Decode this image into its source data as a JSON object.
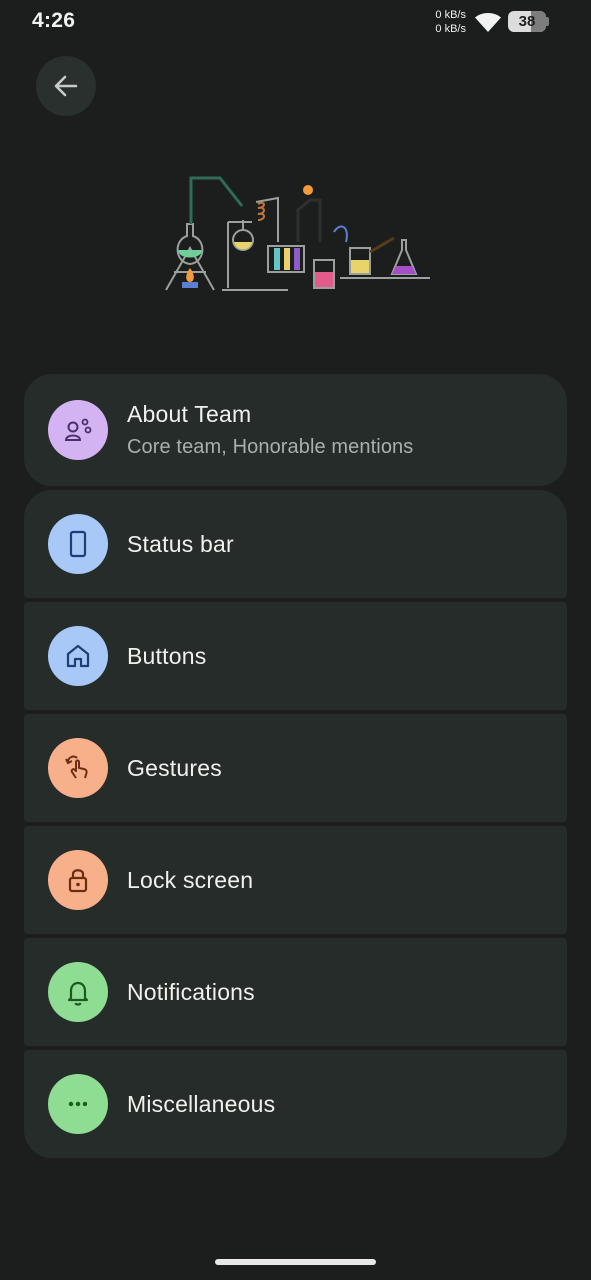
{
  "status_bar": {
    "time": "4:26",
    "net_up": "0 kB/s",
    "net_down": "0 kB/s",
    "battery_level": "38",
    "wifi_icon": "wifi-icon"
  },
  "header": {
    "back_icon": "arrow-back-icon",
    "illustration": "chemistry-lab-illustration"
  },
  "menu": {
    "about": {
      "title": "About Team",
      "subtitle": "Core team, Honorable mentions",
      "icon": "team-icon",
      "color": "#d4b3f2"
    },
    "status_bar": {
      "title": "Status bar",
      "icon": "phone-icon",
      "color": "#a8c8f8"
    },
    "buttons": {
      "title": "Buttons",
      "icon": "home-icon",
      "color": "#a8c8f8"
    },
    "gestures": {
      "title": "Gestures",
      "icon": "swipe-gesture-icon",
      "color": "#f8b08a"
    },
    "lock_screen": {
      "title": "Lock screen",
      "icon": "lock-icon",
      "color": "#f8b08a"
    },
    "notifications": {
      "title": "Notifications",
      "icon": "bell-icon",
      "color": "#8fdc93"
    },
    "misc": {
      "title": "Miscellaneous",
      "icon": "more-horiz-icon",
      "color": "#8fdc93"
    }
  },
  "colors": {
    "background": "#1b1e1c",
    "card": "#262c29",
    "text_primary": "#eef1ed",
    "text_secondary": "#a9b0ab"
  }
}
